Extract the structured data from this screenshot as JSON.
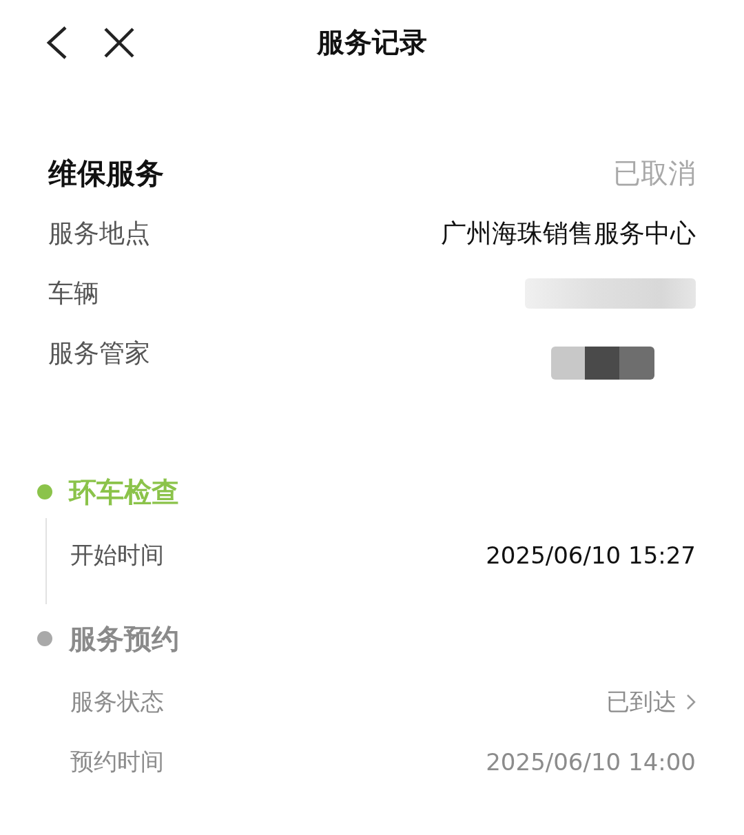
{
  "header": {
    "title": "服务记录"
  },
  "service": {
    "title": "维保服务",
    "status": "已取消",
    "rows": [
      {
        "label": "服务地点",
        "kind": "text",
        "value": "广州海珠销售服务中心"
      },
      {
        "label": "车辆",
        "kind": "redacted"
      },
      {
        "label": "服务管家",
        "kind": "redacted"
      }
    ]
  },
  "timeline": [
    {
      "title": "环车检查",
      "active": true,
      "rows": [
        {
          "label": "开始时间",
          "value": "2025/06/10 15:27",
          "link": false
        }
      ]
    },
    {
      "title": "服务预约",
      "active": false,
      "rows": [
        {
          "label": "服务状态",
          "value": "已到达",
          "link": true
        },
        {
          "label": "预约时间",
          "value": "2025/06/10 14:00",
          "link": false
        }
      ]
    }
  ]
}
